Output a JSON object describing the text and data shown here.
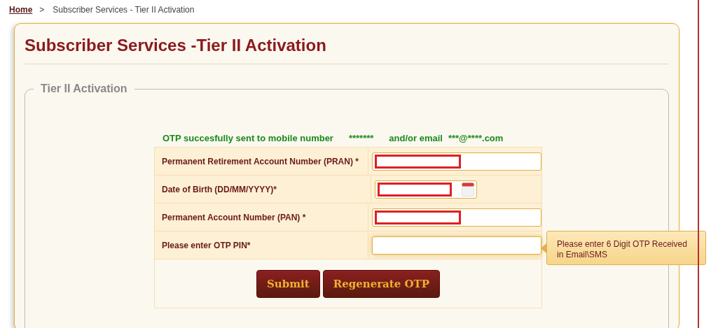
{
  "breadcrumb": {
    "home": "Home",
    "separator": ">",
    "current": "Subscriber Services - Tier II Activation"
  },
  "title": "Subscriber Services -Tier II Activation",
  "section": {
    "legend": "Tier II Activation"
  },
  "message": {
    "text": "OTP succesfully sent to mobile number",
    "mobile": "*******",
    "joiner": "and/or email",
    "email": "***@****.com"
  },
  "fields": [
    {
      "label": "Permanent Retirement Account Number (PRAN) *",
      "kind": "text",
      "redacted": true,
      "focused": false
    },
    {
      "label": "Date of Birth (DD/MM/YYYY)*",
      "kind": "date",
      "redacted": true,
      "focused": false
    },
    {
      "label": "Permanent Account Number (PAN) *",
      "kind": "text",
      "redacted": true,
      "focused": false
    },
    {
      "label": "Please enter OTP PIN*",
      "kind": "text",
      "redacted": false,
      "focused": true
    }
  ],
  "tooltip": "Please enter 6 Digit OTP Received in Email\\SMS",
  "buttons": [
    "Submit",
    "Regenerate OTP"
  ]
}
